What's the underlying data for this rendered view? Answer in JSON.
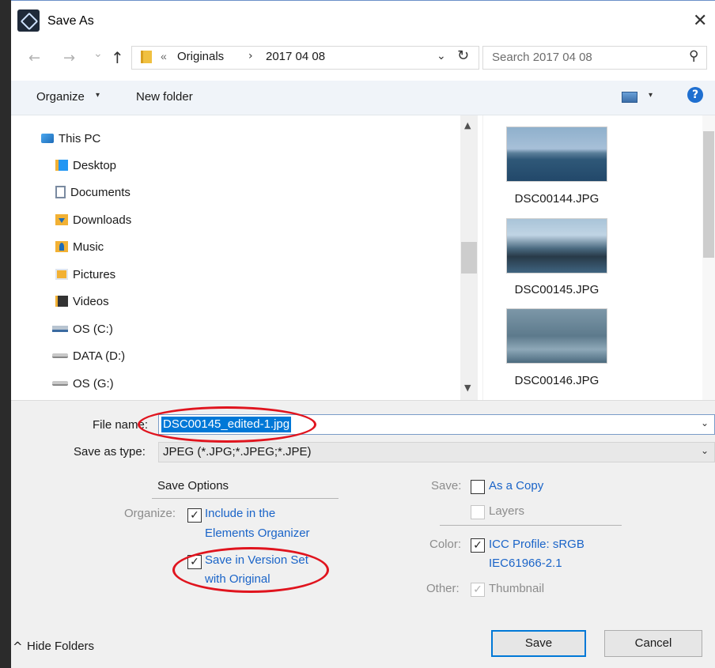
{
  "window": {
    "title": "Save As",
    "close_glyph": "✕"
  },
  "nav": {
    "back_glyph": "←",
    "forward_glyph": "→",
    "recent_glyph": "⌄",
    "up_glyph": "↑",
    "breadcrumb_prefix": "«",
    "breadcrumbs": [
      "Originals",
      "2017 04 08"
    ],
    "crumb_sep": "›",
    "dropdown_glyph": "⌄",
    "refresh_glyph": "↻",
    "search_placeholder": "Search 2017 04 08",
    "search_glyph": "⚲"
  },
  "toolbar": {
    "organize": "Organize",
    "caret": "▾",
    "new_folder": "New folder",
    "help": "?"
  },
  "sidebar": {
    "items": [
      {
        "label": "This PC",
        "icon": "this-pc-icon"
      },
      {
        "label": "Desktop",
        "icon": "desktop-folder-icon"
      },
      {
        "label": "Documents",
        "icon": "documents-folder-icon"
      },
      {
        "label": "Downloads",
        "icon": "downloads-folder-icon"
      },
      {
        "label": "Music",
        "icon": "music-folder-icon"
      },
      {
        "label": "Pictures",
        "icon": "pictures-folder-icon"
      },
      {
        "label": "Videos",
        "icon": "videos-folder-icon"
      },
      {
        "label": "OS (C:)",
        "icon": "system-drive-icon"
      },
      {
        "label": "DATA (D:)",
        "icon": "drive-icon"
      },
      {
        "label": "OS (G:)",
        "icon": "drive-icon"
      }
    ],
    "scroll_up": "▲",
    "scroll_down": "▼"
  },
  "files": {
    "items": [
      {
        "name": "DSC00144.JPG"
      },
      {
        "name": "DSC00145.JPG"
      },
      {
        "name": "DSC00146.JPG"
      }
    ]
  },
  "form": {
    "file_name_label": "File name:",
    "file_name_value": "DSC00145_edited-1.jpg",
    "save_as_type_label": "Save as type:",
    "save_as_type_value": "JPEG (*.JPG;*.JPEG;*.JPE)",
    "dropdown_glyph": "⌄"
  },
  "options": {
    "header": "Save Options",
    "organize_label": "Organize:",
    "include_organizer_line1": "Include in the",
    "include_organizer_line2": "Elements Organizer",
    "version_set_line1": "Save in Version Set",
    "version_set_line2": "with Original",
    "save_label": "Save:",
    "as_copy": "As a Copy",
    "layers": "Layers",
    "color_label": "Color:",
    "icc_line1": "ICC Profile:  sRGB",
    "icc_line2": "IEC61966-2.1",
    "other_label": "Other:",
    "thumbnail": "Thumbnail",
    "check": "✓",
    "state": {
      "include_organizer": true,
      "version_set": true,
      "as_copy": false,
      "layers": false,
      "icc_profile": true,
      "thumbnail": true
    }
  },
  "footer": {
    "hide_folders_glyph": "^",
    "hide_folders": "Hide Folders",
    "save": "Save",
    "cancel": "Cancel"
  },
  "colors": {
    "accent": "#0078d7",
    "link_blue": "#1a64c8",
    "annotation_red": "#e0141e",
    "dialog_bg": "#f0f0f0"
  }
}
